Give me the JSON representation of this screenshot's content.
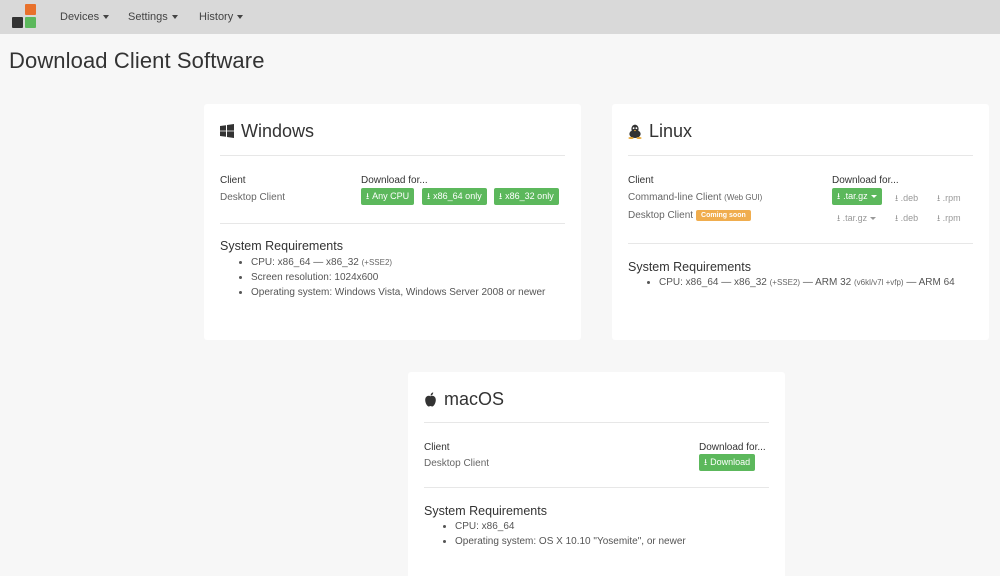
{
  "nav": {
    "items": [
      {
        "label": "Devices"
      },
      {
        "label": "Settings"
      },
      {
        "label": "History"
      }
    ]
  },
  "page": {
    "title": "Download Client Software"
  },
  "windows": {
    "title": "Windows",
    "client_label": "Client",
    "download_for": "Download for...",
    "client_name": "Desktop Client",
    "buttons": [
      "Any CPU",
      "x86_64 only",
      "x86_32 only"
    ],
    "req_title": "System Requirements",
    "req_cpu_prefix": "CPU: x86_64 — x86_32",
    "req_cpu_note": "(+SSE2)",
    "req_screen": "Screen resolution: 1024x600",
    "req_os": "Operating system: Windows Vista, Windows Server 2008 or newer"
  },
  "linux": {
    "title": "Linux",
    "client_label": "Client",
    "download_for": "Download for...",
    "cli_name": "Command-line Client",
    "cli_note": "(Web GUI)",
    "desktop_name": "Desktop Client",
    "coming_soon": "Coming soon",
    "targz": ".tar.gz",
    "deb": ".deb",
    "rpm": ".rpm",
    "req_title": "System Requirements",
    "req_cpu_a": "CPU: x86_64 — x86_32",
    "req_cpu_a_note": "(+SSE2)",
    "req_cpu_b": "— ARM 32",
    "req_cpu_b_note": "(v6kl/v7l +vfp)",
    "req_cpu_c": "— ARM 64"
  },
  "macos": {
    "title": "macOS",
    "client_label": "Client",
    "download_for": "Download for...",
    "client_name": "Desktop Client",
    "button": "Download",
    "req_title": "System Requirements",
    "req_cpu": "CPU: x86_64",
    "req_os": "Operating system: OS X 10.10 \"Yosemite\", or newer"
  },
  "colors": {
    "accent_green": "#5cb85c",
    "badge_orange": "#f0ad4e",
    "navbar": "#d9d9d9"
  }
}
